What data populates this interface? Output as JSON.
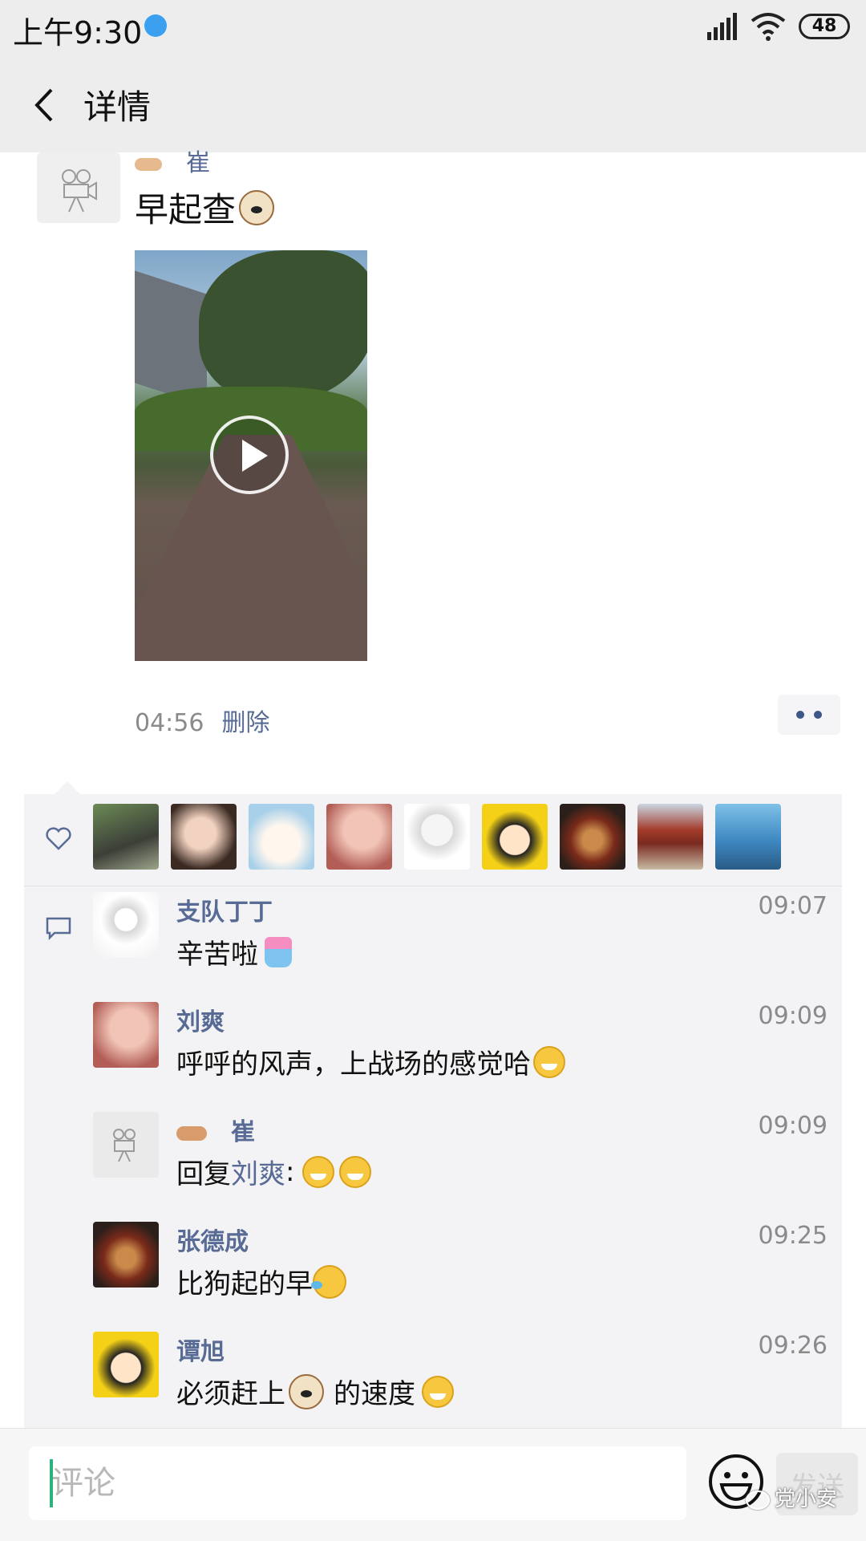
{
  "status_bar": {
    "time": "上午9:30",
    "battery": "48"
  },
  "header": {
    "title": "详情"
  },
  "post": {
    "author": "崔",
    "text": "早起查",
    "time": "04:56",
    "delete_label": "删除"
  },
  "comments": [
    {
      "name": "支队丁丁",
      "time": "09:07",
      "text": "辛苦啦"
    },
    {
      "name": "刘爽",
      "time": "09:09",
      "text": "呼呼的风声，上战场的感觉哈"
    },
    {
      "name": "崔",
      "time": "09:09",
      "reply_prefix": "回复",
      "reply_to": "刘爽",
      "reply_suffix": ":"
    },
    {
      "name": "张德成",
      "time": "09:25",
      "text": "比狗起的早"
    },
    {
      "name": "谭旭",
      "time": "09:26",
      "text_a": "必须赶上",
      "text_b": "的速度"
    }
  ],
  "composer": {
    "placeholder": "评论",
    "send_label": "发送"
  },
  "watermark": "党小安",
  "colors": {
    "link": "#576b95",
    "header_bg": "#ededed",
    "panel_bg": "#f3f3f5"
  }
}
